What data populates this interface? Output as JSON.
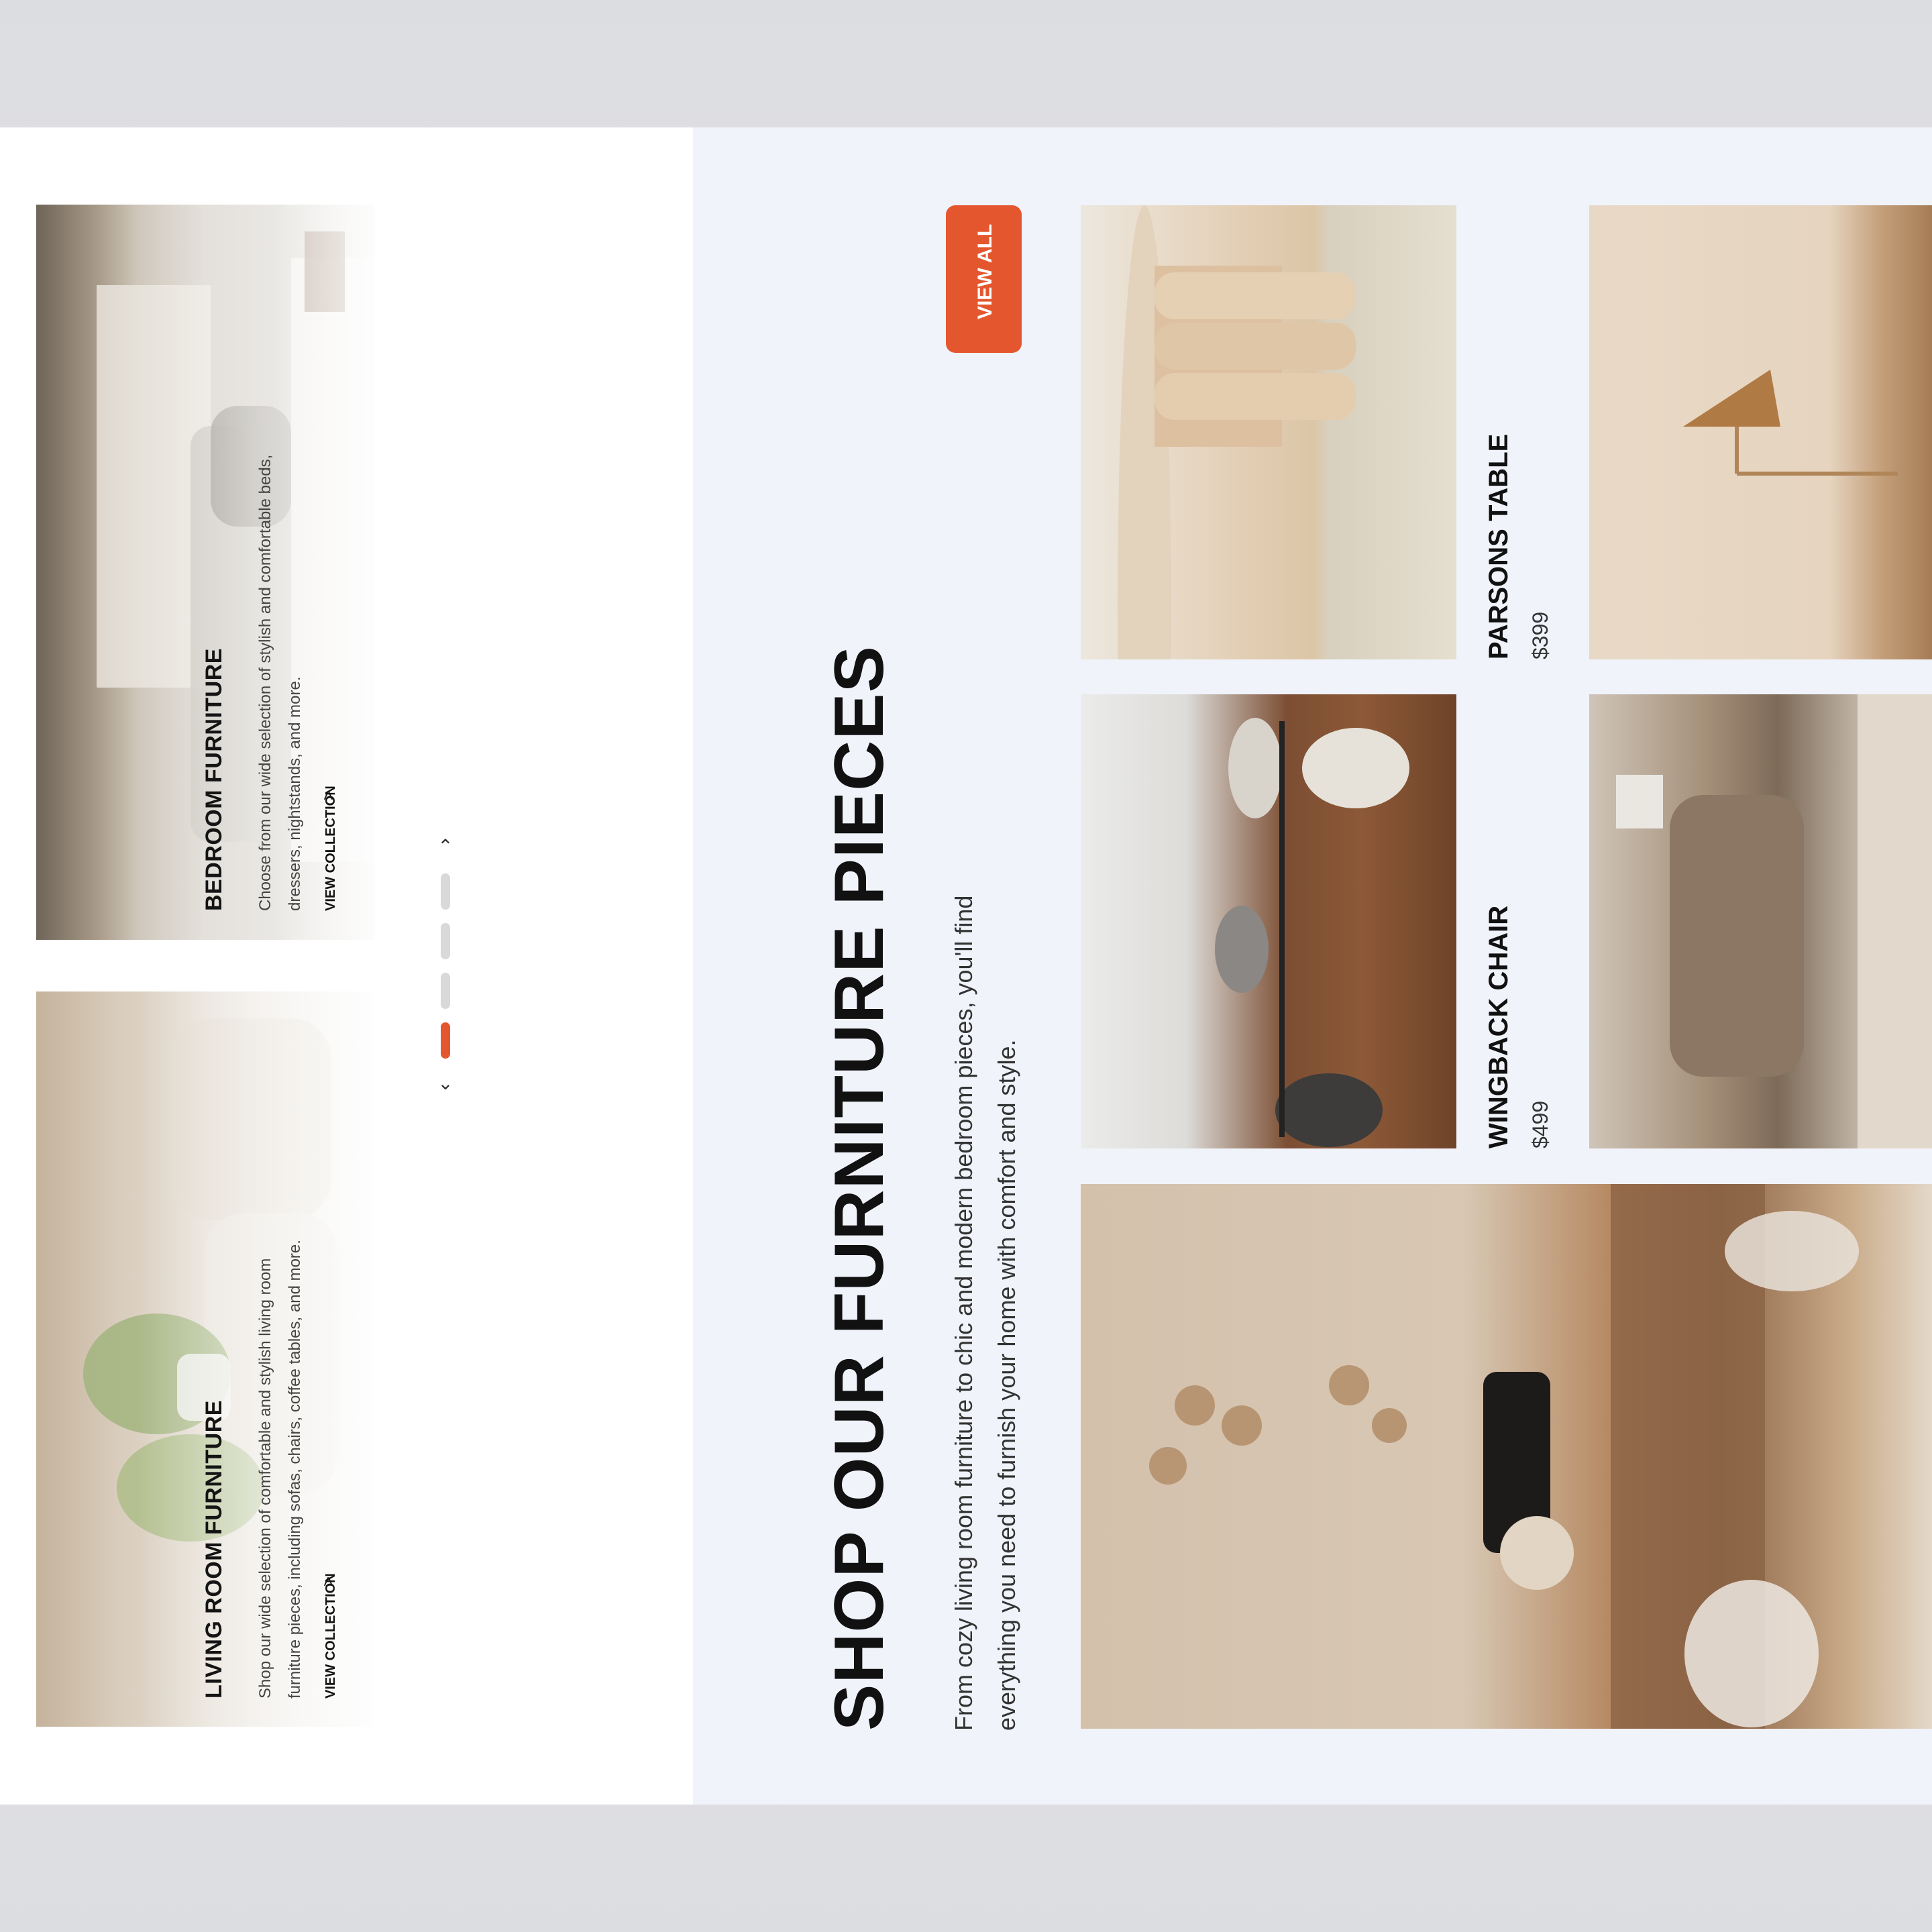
{
  "collections": [
    {
      "title": "BEDROOM FURNITURE",
      "description": "Choose from our wide selection of stylish and comfortable beds, dressers, nightstands, and more.",
      "link": "VIEW COLLECTION"
    },
    {
      "title": "LIVING ROOM FURNITURE",
      "description": "Shop our wide selection of comfortable and stylish living room furniture pieces, including sofas, chairs, coffee tables, and more.",
      "link": "VIEW COLLECTION"
    }
  ],
  "slider": {
    "total": 4,
    "active_index": 3,
    "up_icon": "chevron-up-icon",
    "down_icon": "chevron-down-icon"
  },
  "section": {
    "heading": "SHOP OUR FURNITURE PIECES",
    "intro": "From cozy living room furniture to chic and modern bedroom pieces, you'll find everything you need to furnish your home with comfort and style.",
    "view_all": "VIEW ALL"
  },
  "products": [
    {
      "name": "PARSONS TABLE",
      "price": "$399"
    },
    {
      "name": "WINGBACK CHAIR",
      "price": "$499"
    }
  ],
  "colors": {
    "accent": "#e4572e",
    "left_panel": "#ffffff",
    "right_panel": "#f0f3fa",
    "text": "#111111"
  }
}
